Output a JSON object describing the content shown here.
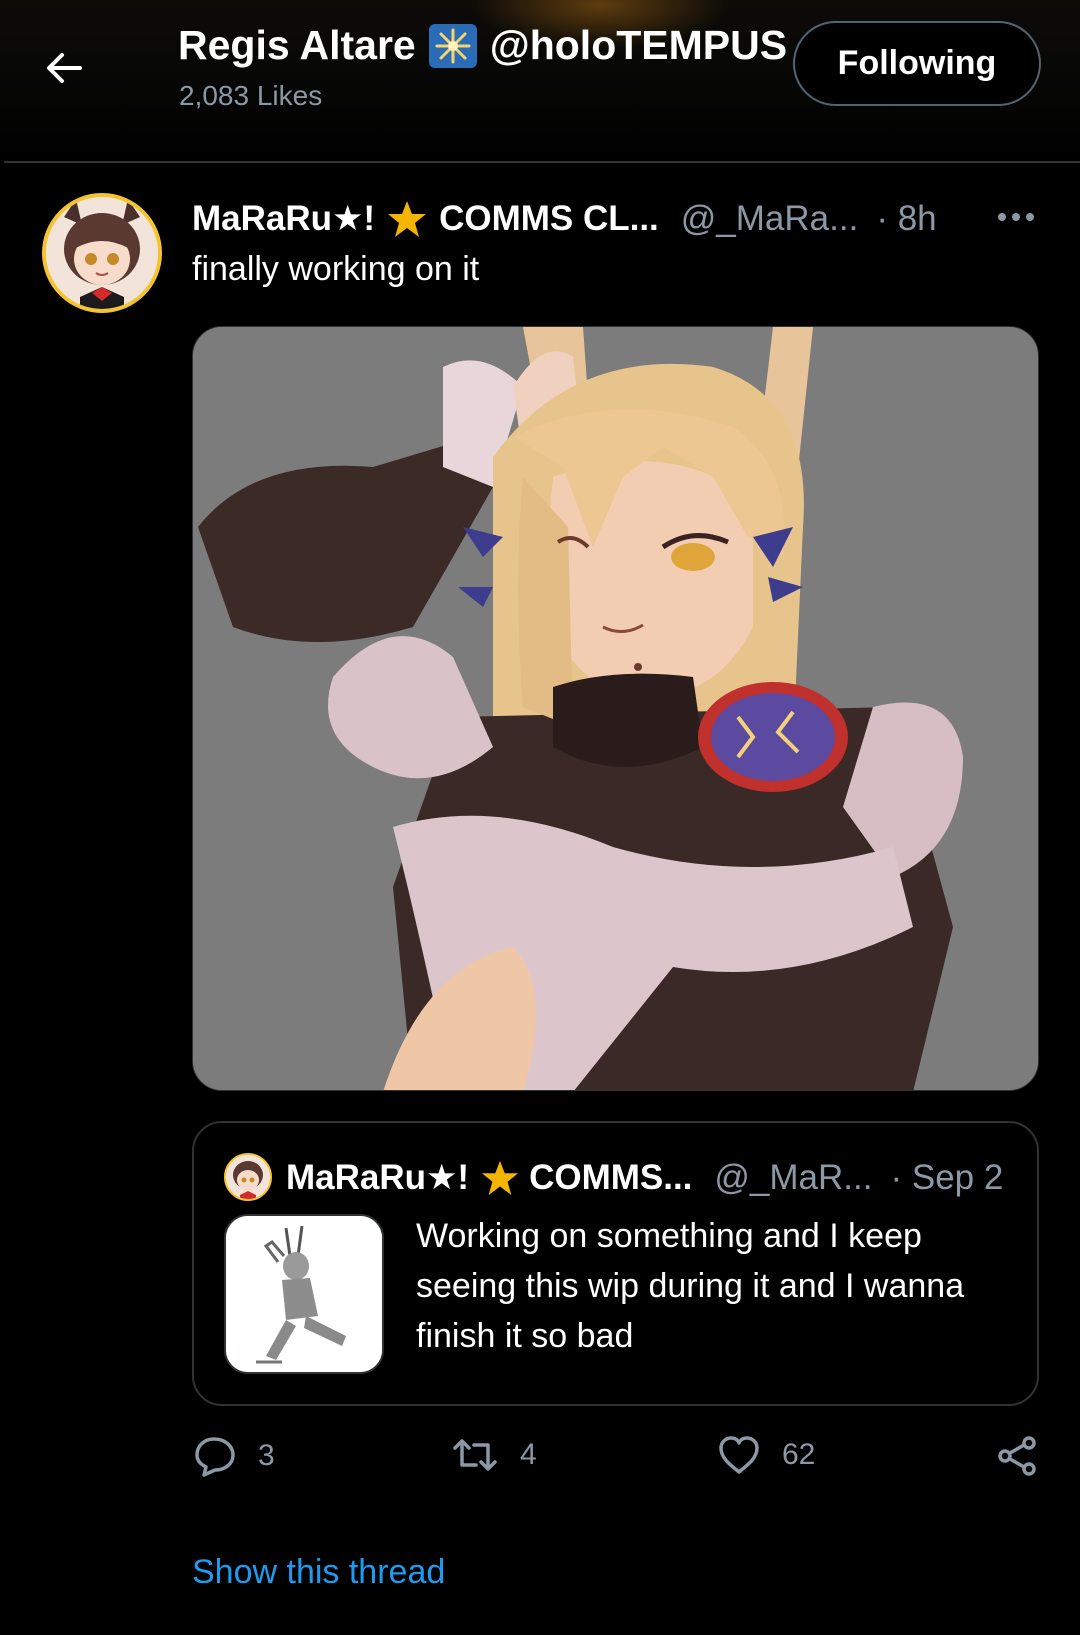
{
  "header": {
    "title_name": "Regis Altare",
    "title_handle": "@holoTEMPUS",
    "likes": "2,083 Likes",
    "follow_label": "Following"
  },
  "tweet": {
    "author_name": "MaRaRu★!",
    "author_name_rest": "COMMS CL...",
    "handle": "@_MaRa...",
    "time": "· 8h",
    "text": "finally working on it"
  },
  "quote": {
    "author_name": "MaRaRu★!",
    "author_name_rest": "COMMS...",
    "handle": "@_MaR...",
    "time": "· Sep 2",
    "text": "Working on something and I keep seeing this wip during it and I wanna finish it so bad"
  },
  "actions": {
    "replies": "3",
    "retweets": "4",
    "likes": "62"
  },
  "footer": {
    "show_thread": "Show this thread"
  },
  "colors": {
    "background": "#000000",
    "accent": "#1d9bf0",
    "muted_text": "#8b98a5",
    "border": "#2f3336",
    "star": "#f4b400"
  },
  "icons": [
    "back-arrow-icon",
    "sparkle-badge-icon",
    "star-icon",
    "more-icon",
    "reply-icon",
    "retweet-icon",
    "heart-icon",
    "share-icon"
  ]
}
